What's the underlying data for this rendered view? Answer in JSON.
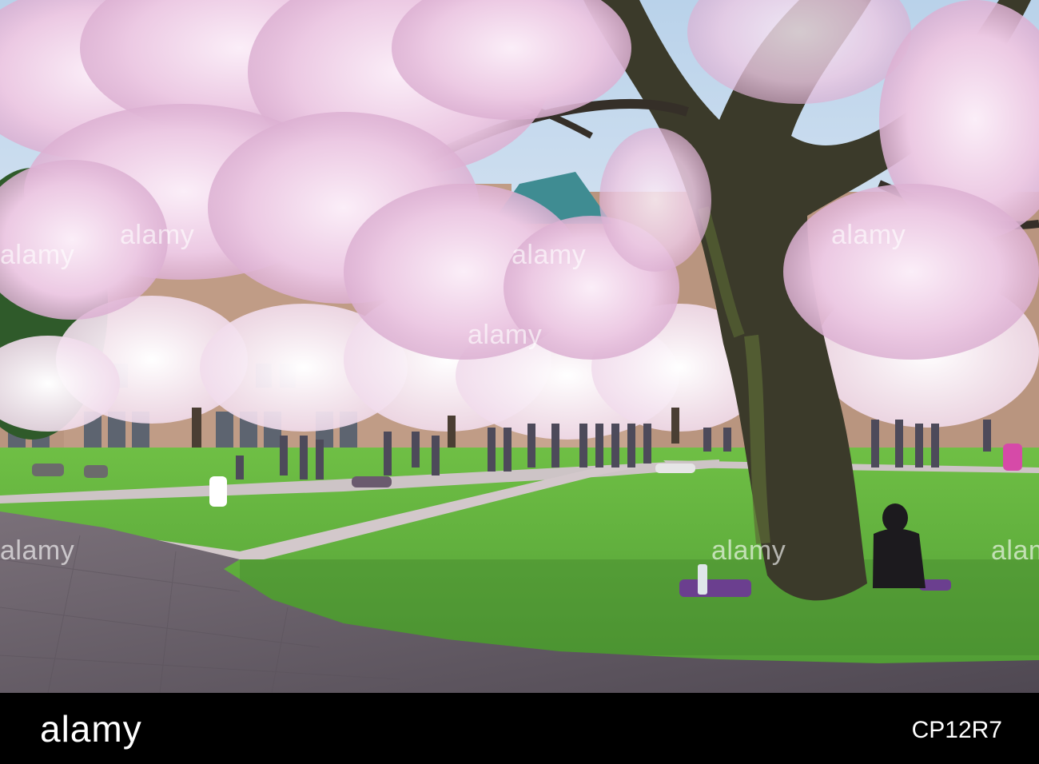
{
  "image": {
    "colors": {
      "sky": "#cfe0f0",
      "grass": "#64b83c",
      "grass_shadow": "#3f7f2c",
      "path": "#c9bfc2",
      "cobblestone": "#6e6670",
      "blossom": "#f2d8ec",
      "blossom_deep": "#d9a8cf",
      "trunk": "#3b3a2a",
      "moss": "#5c6b36",
      "building": "#b6927e",
      "roof": "#3f8c92"
    }
  },
  "watermark": {
    "text": "alamy"
  },
  "footer": {
    "logo": "alamy",
    "image_id": "CP12R7",
    "background": "#000000"
  }
}
